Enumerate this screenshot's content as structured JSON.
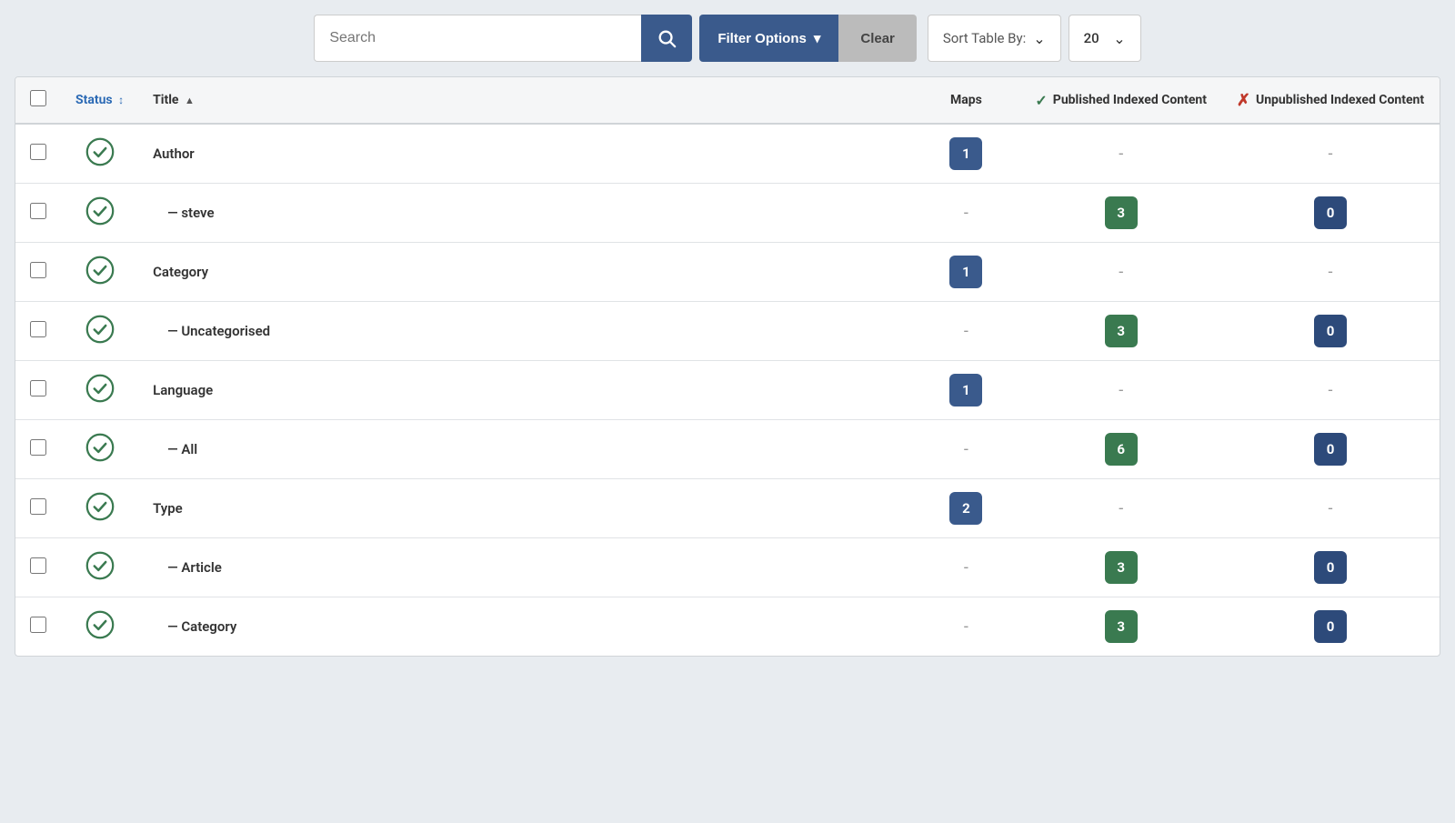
{
  "toolbar": {
    "search_placeholder": "Search",
    "search_button_icon": "search-icon",
    "filter_button_label": "Filter Options",
    "filter_chevron": "▾",
    "clear_button_label": "Clear",
    "sort_label": "Sort Table By:",
    "sort_chevron": "⌄",
    "page_size_value": "20",
    "page_size_chevron": "⌄"
  },
  "table": {
    "columns": {
      "checkbox": "",
      "status": "Status",
      "status_arrow": "↕",
      "title": "Title",
      "title_arrow": "▲",
      "maps": "Maps",
      "published": "Published Indexed Content",
      "published_icon": "✓",
      "unpublished": "Unpublished Indexed Content",
      "unpublished_icon": "✗"
    },
    "rows": [
      {
        "id": 1,
        "checked": false,
        "status": "active",
        "title": "Author",
        "indent": false,
        "maps": "1",
        "maps_color": "blue",
        "published": "-",
        "unpublished": "-",
        "show_published_badge": false,
        "show_unpublished_badge": false,
        "published_value": "",
        "unpublished_value": ""
      },
      {
        "id": 2,
        "checked": false,
        "status": "active",
        "title": "— steve",
        "indent": true,
        "maps": "-",
        "maps_color": "",
        "published": "3",
        "unpublished": "0",
        "show_published_badge": true,
        "show_unpublished_badge": true,
        "published_value": "3",
        "unpublished_value": "0"
      },
      {
        "id": 3,
        "checked": false,
        "status": "active",
        "title": "Category",
        "indent": false,
        "maps": "1",
        "maps_color": "blue",
        "published": "-",
        "unpublished": "-",
        "show_published_badge": false,
        "show_unpublished_badge": false,
        "published_value": "",
        "unpublished_value": ""
      },
      {
        "id": 4,
        "checked": false,
        "status": "active",
        "title": "— Uncategorised",
        "indent": true,
        "maps": "-",
        "maps_color": "",
        "published": "3",
        "unpublished": "0",
        "show_published_badge": true,
        "show_unpublished_badge": true,
        "published_value": "3",
        "unpublished_value": "0"
      },
      {
        "id": 5,
        "checked": false,
        "status": "active",
        "title": "Language",
        "indent": false,
        "maps": "1",
        "maps_color": "blue",
        "published": "-",
        "unpublished": "-",
        "show_published_badge": false,
        "show_unpublished_badge": false,
        "published_value": "",
        "unpublished_value": ""
      },
      {
        "id": 6,
        "checked": false,
        "status": "active",
        "title": "— All",
        "indent": true,
        "maps": "-",
        "maps_color": "",
        "published": "6",
        "unpublished": "0",
        "show_published_badge": true,
        "show_unpublished_badge": true,
        "published_value": "6",
        "unpublished_value": "0"
      },
      {
        "id": 7,
        "checked": false,
        "status": "active",
        "title": "Type",
        "indent": false,
        "maps": "2",
        "maps_color": "blue",
        "published": "-",
        "unpublished": "-",
        "show_published_badge": false,
        "show_unpublished_badge": false,
        "published_value": "",
        "unpublished_value": ""
      },
      {
        "id": 8,
        "checked": false,
        "status": "active",
        "title": "— Article",
        "indent": true,
        "maps": "-",
        "maps_color": "",
        "published": "3",
        "unpublished": "0",
        "show_published_badge": true,
        "show_unpublished_badge": true,
        "published_value": "3",
        "unpublished_value": "0"
      },
      {
        "id": 9,
        "checked": false,
        "status": "active",
        "title": "— Category",
        "indent": true,
        "maps": "-",
        "maps_color": "",
        "published": "3",
        "unpublished": "0",
        "show_published_badge": true,
        "show_unpublished_badge": true,
        "published_value": "3",
        "unpublished_value": "0"
      }
    ]
  }
}
